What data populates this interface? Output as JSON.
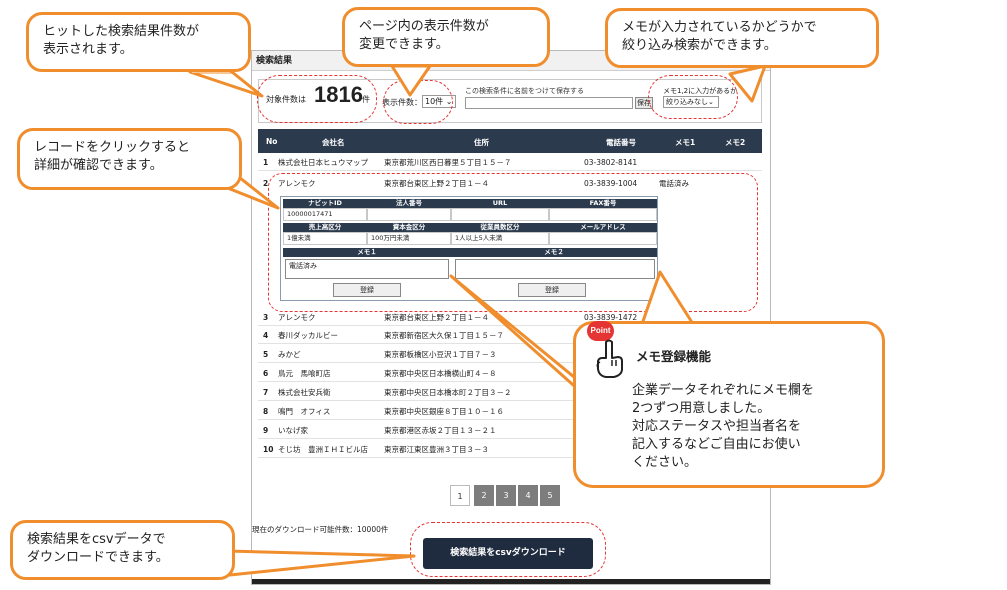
{
  "window": {
    "title": "検索結果"
  },
  "summary": {
    "count_label": "対象件数は",
    "count_value": "1816",
    "count_unit": "件",
    "per_page_label": "表示件数：",
    "per_page_value": "10件",
    "save_label": "この検索条件に名前をつけて保存する",
    "save_button": "保存",
    "memo_filter_label": "メモ1,2に入力があるか",
    "memo_filter_value": "絞り込みなし"
  },
  "table": {
    "headers": {
      "no": "No",
      "name": "会社名",
      "address": "住所",
      "tel": "電話番号",
      "memo1": "メモ1",
      "memo2": "メモ2"
    },
    "rows": [
      {
        "no": "1",
        "name": "株式会社日本ヒュウマップ",
        "address": "東京都荒川区西日暮里５丁目１５－７",
        "tel": "03-3802-8141",
        "memo1": ""
      },
      {
        "no": "2",
        "name": "アレンモク",
        "address": "東京都台東区上野２丁目１－４",
        "tel": "03-3839-1004",
        "memo1": "電話済み"
      },
      {
        "no": "3",
        "name": "アレンモク",
        "address": "東京都台東区上野２丁目１－４",
        "tel": "03-3839-1472",
        "memo1": ""
      },
      {
        "no": "4",
        "name": "春川ダッカルビー",
        "address": "東京都新宿区大久保１丁目１５－７",
        "tel": "",
        "memo1": ""
      },
      {
        "no": "5",
        "name": "みかど",
        "address": "東京都板橋区小豆沢１丁目７－３",
        "tel": "",
        "memo1": ""
      },
      {
        "no": "6",
        "name": "鳥元　馬喰町店",
        "address": "東京都中央区日本橋横山町４－８",
        "tel": "",
        "memo1": ""
      },
      {
        "no": "7",
        "name": "株式会社安兵衛",
        "address": "東京都中央区日本橋本町２丁目３－２",
        "tel": "",
        "memo1": ""
      },
      {
        "no": "8",
        "name": "鳴門　オフィス",
        "address": "東京都中央区銀座８丁目１０－１６",
        "tel": "",
        "memo1": ""
      },
      {
        "no": "9",
        "name": "いなげ家",
        "address": "東京都港区赤坂２丁目１３－２１",
        "tel": "",
        "memo1": ""
      },
      {
        "no": "10",
        "name": "そじ坊　豊洲ＩＨＩビル店",
        "address": "東京都江東区豊洲３丁目３－３",
        "tel": "",
        "memo1": ""
      }
    ]
  },
  "detail": {
    "h_navit": "ナビットID",
    "h_corp": "法人番号",
    "h_url": "URL",
    "h_fax": "FAX番号",
    "v_navit": "10000017471",
    "v_corp": "",
    "v_url": "",
    "v_fax": "",
    "h_sales": "売上高区分",
    "h_capital": "資本金区分",
    "h_staff": "従業員数区分",
    "h_mail": "メールアドレス",
    "v_sales": "1億未満",
    "v_capital": "100万円未満",
    "v_staff": "1人以上5人未満",
    "v_mail": "",
    "h_memo1": "メモ１",
    "h_memo2": "メモ２",
    "memo1_value": "電話済み",
    "memo2_value": "",
    "register_label": "登録"
  },
  "pager": {
    "pages": [
      "1",
      "2",
      "3",
      "4",
      "5"
    ],
    "active": "1"
  },
  "download": {
    "count_text": "現在のダウンロード可能件数：10000件",
    "button_label": "検索結果をcsvダウンロード"
  },
  "callouts": {
    "hits": "ヒットした検索結果件数が\n表示されます。",
    "per_page": "ページ内の表示件数が\n変更できます。",
    "memo_filter": "メモが入力されているかどうかで\n絞り込み検索ができます。",
    "click_record": "レコードをクリックすると\n詳細が確認できます。",
    "csv": "検索結果をcsvデータで\nダウンロードできます。"
  },
  "feature": {
    "badge": "Point",
    "title": "メモ登録機能",
    "body": "企業データそれぞれにメモ欄を\n2つずつ用意しました。\n対応ステータスや担当者名を\n記入するなどご自由にお使い\nください。"
  },
  "colors": {
    "accent_orange": "#f08d2c",
    "dash_red": "#e53434",
    "header_navy": "#2b3a4d",
    "button_navy": "#1f2c3f"
  }
}
